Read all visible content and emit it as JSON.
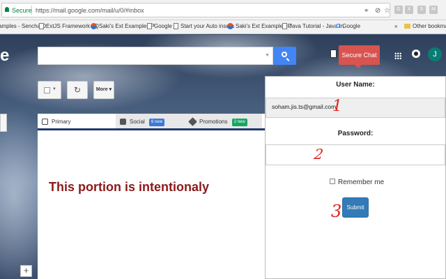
{
  "browser": {
    "secure_label": "Secure",
    "url": "https://mail.google.com/mail/u/0/#inbox",
    "extensions": [
      "G",
      "X",
      "S",
      "M"
    ],
    "bookmarks": [
      {
        "label": "amples - Sencha D",
        "icon": "page-icon"
      },
      {
        "label": "ExtJS Framework | Q",
        "icon": "page-icon"
      },
      {
        "label": "Saki's Ext Examples P",
        "icon": "globe-icon"
      },
      {
        "label": "Google",
        "icon": "page-icon"
      },
      {
        "label": "Start your Auto insura",
        "icon": "page-icon"
      },
      {
        "label": "Saki's Ext Examples P",
        "icon": "globe-icon"
      },
      {
        "label": "Java Tutorial - Java In",
        "icon": "page-icon"
      },
      {
        "label": "Google",
        "icon": "google-icon"
      }
    ],
    "overflow": "»",
    "other_bookmarks": "Other bookmarks"
  },
  "gmail": {
    "logo_fragment": "e",
    "more_label": "More",
    "avatar_initial": "J",
    "secure_chat_label": "Secure Chat",
    "tabs": [
      {
        "label": "Primary"
      },
      {
        "label": "Social",
        "badge": "6 new"
      },
      {
        "label": "Promotions",
        "badge": "2 new"
      }
    ],
    "note": "This portion is intentionaly",
    "plus": "+"
  },
  "login": {
    "username_label": "User Name:",
    "username_value": "soham.jis.ts@gmail.com",
    "password_label": "Password:",
    "remember_label": "Remember me",
    "submit_label": "Submit"
  },
  "annotations": [
    "1",
    "2",
    "3"
  ],
  "colors": {
    "secure_chat": "#d9534f",
    "submit": "#337ab7",
    "search_button": "#4285f4",
    "annotation": "#e0221c",
    "note_text": "#8b1a1a"
  }
}
